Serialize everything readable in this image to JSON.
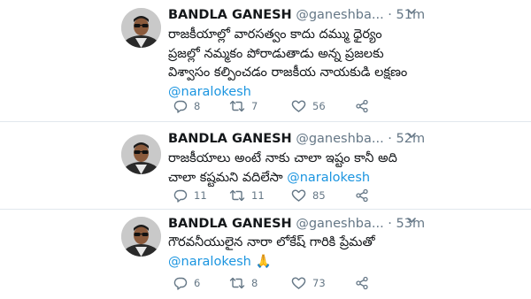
{
  "tweets": [
    {
      "name": "BANDLA GANESH",
      "handle": "@ganeshba...",
      "separator": "·",
      "time": "51m",
      "lines": [
        "రాజకీయాల్లో వారసత్వం కాదు దమ్ము ధైర్యం",
        "ప్రజల్లో నమ్మకం పోరాడుతాడు అన్న ప్రజలకు",
        "విశ్వాసం కల్పించడం రాజకీయ నాయకుడి లక్షణం"
      ],
      "mention": "@naralokesh",
      "emoji": "",
      "replies": "8",
      "retweets": "7",
      "likes": "56"
    },
    {
      "name": "BANDLA GANESH",
      "handle": "@ganeshba...",
      "separator": "·",
      "time": "52m",
      "lines": [
        "రాజకీయాలు అంటే నాకు చాలా ఇష్టం కానీ అది"
      ],
      "prefix": "చాలా కష్టమని వదిలేసా ",
      "mention": "@naralokesh",
      "emoji": "",
      "replies": "11",
      "retweets": "11",
      "likes": "85"
    },
    {
      "name": "BANDLA GANESH",
      "handle": "@ganeshba...",
      "separator": "·",
      "time": "53m",
      "lines": [
        "గౌరవనీయులైన నారా లోకేష్ గారికి ప్రేమతో"
      ],
      "mention": "@naralokesh",
      "emoji": "🙏",
      "replies": "6",
      "retweets": "8",
      "likes": "73"
    }
  ],
  "icons": {
    "reply": "reply-icon",
    "retweet": "retweet-icon",
    "like": "heart-icon",
    "share": "share-icon",
    "more": "chevron-down-icon"
  },
  "colors": {
    "mention": "#1b95e0",
    "muted": "#657786",
    "text": "#14171a",
    "divider": "#e1e8ed"
  }
}
